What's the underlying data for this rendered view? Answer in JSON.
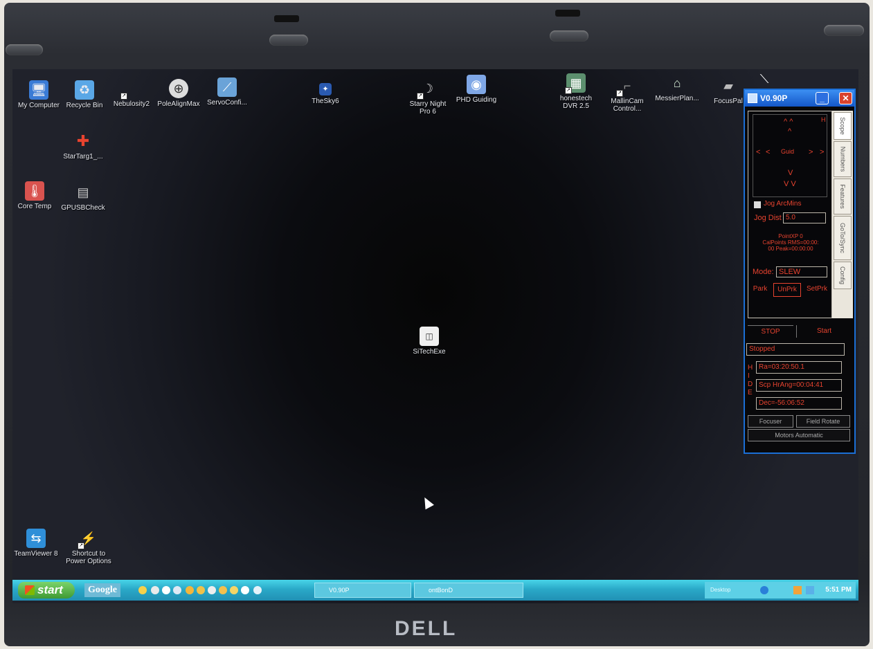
{
  "desktop": {
    "icons": [
      {
        "label": "My Computer",
        "icon": "computer-icon",
        "color": "#3a7bd5"
      },
      {
        "label": "Recycle Bin",
        "icon": "recycle-bin-icon",
        "color": "#5aa7e6"
      },
      {
        "label": "Nebulosity2",
        "icon": "shortcut-icon",
        "color": "#777777"
      },
      {
        "label": "PoleAlignMax",
        "icon": "crosshair-icon",
        "color": "#dddddd"
      },
      {
        "label": "ServoConfi...",
        "icon": "servo-icon",
        "color": "#6aa3d8"
      },
      {
        "label": "TheSky6",
        "icon": "sky-icon",
        "color": "#2a5ab0"
      },
      {
        "label": "Starry Night\nPro 6",
        "icon": "moon-icon",
        "color": "#dddddd"
      },
      {
        "label": "PHD Guiding",
        "icon": "phd-icon",
        "color": "#7fa7e6"
      },
      {
        "label": "honestech\nDVR 2.5",
        "icon": "dvr-icon",
        "color": "#5c8f6e"
      },
      {
        "label": "MallinCam\nControl...",
        "icon": "camera-icon",
        "color": "#999999"
      },
      {
        "label": "MessierPlan...",
        "icon": "planner-icon",
        "color": "#cfe6cf"
      },
      {
        "label": "FocusPal",
        "icon": "focuser-icon",
        "color": "#bbbbbb"
      },
      {
        "label": "StarTarg1_...",
        "icon": "target-icon",
        "color": "#e8432f"
      },
      {
        "label": "Core Temp",
        "icon": "thermometer-icon",
        "color": "#d9534f"
      },
      {
        "label": "GPUSBCheck",
        "icon": "usb-icon",
        "color": "#cccccc"
      },
      {
        "label": "SiTechExe",
        "icon": "app-icon",
        "color": "#f0f0f0"
      },
      {
        "label": "TeamViewer 8",
        "icon": "teamviewer-icon",
        "color": "#2f8fd8"
      },
      {
        "label": "Shortcut to\nPower Options",
        "icon": "power-icon",
        "color": "#dddddd"
      }
    ]
  },
  "control_window": {
    "title": "V0.90P",
    "pad": {
      "up_fast": "^ ^",
      "up": "^",
      "h": "H",
      "left_fast": "<",
      "left": "<",
      "guid": "Guid",
      "right": ">",
      "right_fast": ">",
      "down": "V",
      "down_fast": "V V"
    },
    "jog_arcmins": "Jog ArcMins",
    "jog_dist_label": "Jog Dist",
    "jog_dist_value": "5.0",
    "point_info": "PointXP 0\nCalPoints RMS=00:00:\n00 Peak=00:00:00",
    "mode_label": "Mode:",
    "mode_value": "SLEW",
    "park": "Park",
    "unpark": "UnPrk",
    "setpark": "SetPrk",
    "tabs": [
      "Scope",
      "Numbers",
      "Features",
      "GoTo/Sync",
      "Config"
    ],
    "stop": "STOP",
    "start": "Start",
    "status": "Stopped",
    "hide": "HIDE",
    "ra": "Ra=03:20:50.1",
    "hour_angle": "Scp HrAng=00:04:41",
    "dec": "Dec=-56:06:52",
    "focuser": "Focuser",
    "field_rotate": "Field Rotate",
    "motors": "Motors Automatic"
  },
  "taskbar": {
    "start_label": "start",
    "google_label": "Google",
    "tasks": [
      "V0.90P",
      "ontBonD"
    ],
    "tray_label": "Desktop",
    "clock": "5:51 PM"
  },
  "brand": "DELL"
}
